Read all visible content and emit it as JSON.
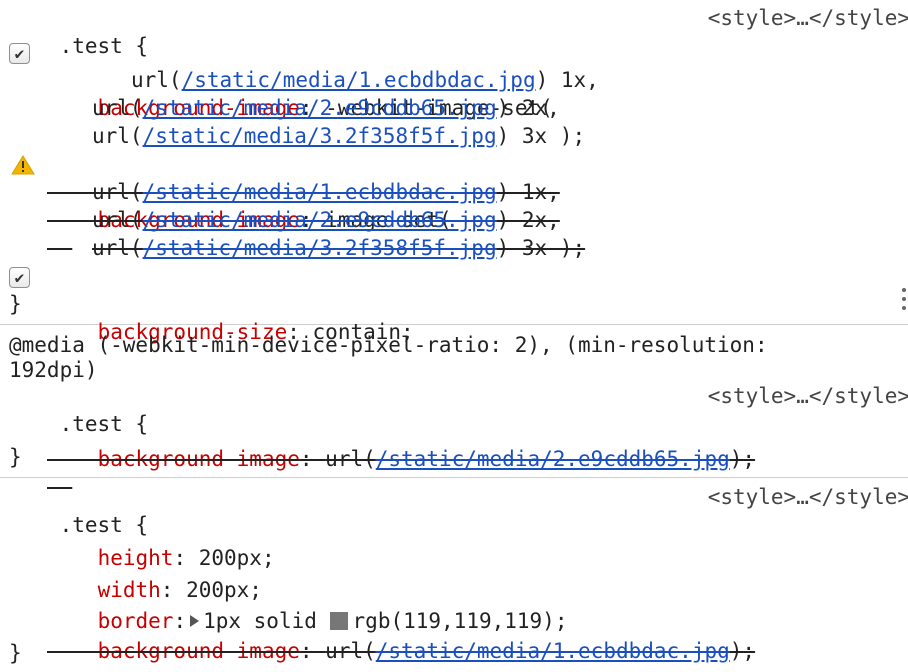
{
  "rules": [
    {
      "selector": ".test {",
      "source": "<style>…</style>",
      "declarations": {
        "bg_webkit": {
          "prop": "background-image",
          "colon": ": ",
          "fn": "-webkit-image-set(",
          "url_prefix": "url(",
          "urls": [
            "/static/media/1.ecbdbdac.jpg",
            "/static/media/2.e9cddb65.jpg",
            "/static/media/3.2f358f5f.jpg"
          ],
          "suffixes": [
            ") 1x,",
            ") 2x,",
            ") 3x );"
          ]
        },
        "bg_imageset": {
          "prop": "background-image",
          "colon": ": ",
          "fn": "image-set(",
          "url_prefix": "url(",
          "urls": [
            "/static/media/1.ecbdbdac.jpg",
            "/static/media/2.e9cddb65.jpg",
            "/static/media/3.2f358f5f.jpg"
          ],
          "suffixes": [
            ") 1x,",
            ") 2x,",
            ") 3x );"
          ]
        },
        "bg_size": {
          "prop": "background-size",
          "colon": ": ",
          "value": "contain;"
        }
      },
      "close": "}"
    },
    {
      "media_line1": "@media (-webkit-min-device-pixel-ratio: 2), (min-resolution:",
      "media_line2": "192dpi)",
      "selector": ".test {",
      "source": "<style>…</style>",
      "decl": {
        "prop": "background-image",
        "colon": ": ",
        "url_prefix": "url(",
        "url": "/static/media/2.e9cddb65.jpg",
        "suffix": ");"
      },
      "close": "}"
    },
    {
      "selector": ".test {",
      "source": "<style>…</style>",
      "height": {
        "prop": "height",
        "colon": ": ",
        "value": "200px;"
      },
      "width": {
        "prop": "width",
        "colon": ": ",
        "value": "200px;"
      },
      "border": {
        "prop": "border",
        "colon": ":",
        "value_a": "1px solid ",
        "color_swatch": "#777777",
        "value_b": "rgb(119,119,119);"
      },
      "bg": {
        "prop": "background-image",
        "colon": ": ",
        "url_prefix": "url(",
        "url": "/static/media/1.ecbdbdac.jpg",
        "suffix": ");"
      },
      "close": "}"
    }
  ],
  "colors": {
    "property": "#c80000",
    "link": "#1a4fbf",
    "warning": "#f2b600"
  }
}
